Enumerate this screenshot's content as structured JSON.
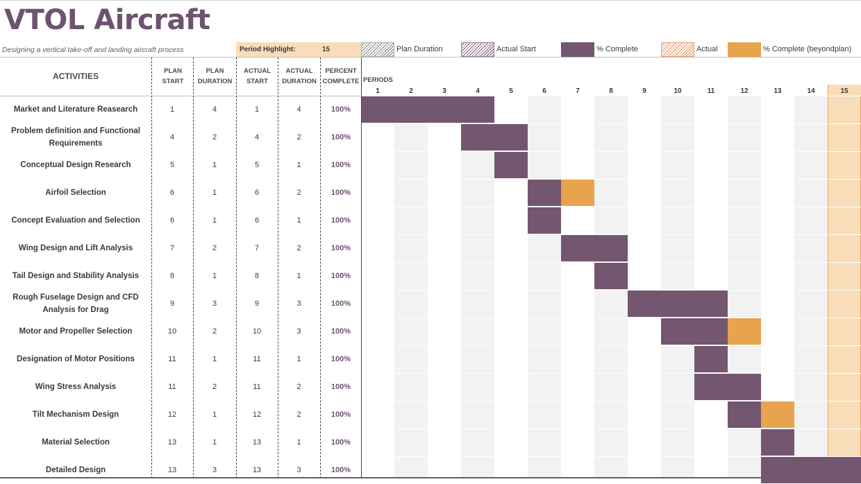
{
  "title": "VTOL Aircraft",
  "subtitle": "Designing a vertical take-off and landing aircraft process",
  "period_highlight": {
    "label": "Period Highlight:",
    "value": "15"
  },
  "legend": [
    {
      "key": "plan-duration",
      "label": "Plan Duration",
      "style": "hatch-gray"
    },
    {
      "key": "actual-start",
      "label": "Actual Start",
      "style": "hatch-purple"
    },
    {
      "key": "percent-complete",
      "label": "% Complete",
      "style": "solid-purple"
    },
    {
      "key": "actual",
      "label": "Actual",
      "style": "hatch-orange"
    },
    {
      "key": "percent-complete-beyond",
      "label": "% Complete (beyondplan)",
      "style": "solid-orange"
    }
  ],
  "colors": {
    "brand": "#6e5370",
    "complete": "#73566f",
    "beyond_plan": "#e8a44d",
    "highlight": "#f8ddb8",
    "alt_column": "#f2f2f2"
  },
  "headers": {
    "activities": "ACTIVITIES",
    "plan_start": [
      "PLAN",
      "START"
    ],
    "plan_duration": [
      "PLAN",
      "DURATION"
    ],
    "actual_start": [
      "ACTUAL",
      "START"
    ],
    "actual_duration": [
      "ACTUAL",
      "DURATION"
    ],
    "percent_complete": [
      "PERCENT",
      "COMPLETE"
    ],
    "periods": "PERIODS"
  },
  "periods": [
    "1",
    "2",
    "3",
    "4",
    "5",
    "6",
    "7",
    "8",
    "9",
    "10",
    "11",
    "12",
    "13",
    "14",
    "15"
  ],
  "activities": [
    {
      "name": "Market and Literature Reasearch",
      "plan_start": 1,
      "plan_duration": 4,
      "actual_start": 1,
      "actual_duration": 4,
      "percent": "100%"
    },
    {
      "name": "Problem definition and Functional Requirements",
      "plan_start": 4,
      "plan_duration": 2,
      "actual_start": 4,
      "actual_duration": 2,
      "percent": "100%"
    },
    {
      "name": "Conceptual Design Research",
      "plan_start": 5,
      "plan_duration": 1,
      "actual_start": 5,
      "actual_duration": 1,
      "percent": "100%"
    },
    {
      "name": "Airfoil Selection",
      "plan_start": 6,
      "plan_duration": 1,
      "actual_start": 6,
      "actual_duration": 2,
      "percent": "100%"
    },
    {
      "name": "Concept Evaluation and Selection",
      "plan_start": 6,
      "plan_duration": 1,
      "actual_start": 6,
      "actual_duration": 1,
      "percent": "100%"
    },
    {
      "name": "Wing Design and Lift Analysis",
      "plan_start": 7,
      "plan_duration": 2,
      "actual_start": 7,
      "actual_duration": 2,
      "percent": "100%"
    },
    {
      "name": "Tail Design and Stability Analysis",
      "plan_start": 8,
      "plan_duration": 1,
      "actual_start": 8,
      "actual_duration": 1,
      "percent": "100%"
    },
    {
      "name": "Rough Fuselage Design and CFD Analysis for Drag",
      "plan_start": 9,
      "plan_duration": 3,
      "actual_start": 9,
      "actual_duration": 3,
      "percent": "100%"
    },
    {
      "name": "Motor and Propeller Selection",
      "plan_start": 10,
      "plan_duration": 2,
      "actual_start": 10,
      "actual_duration": 3,
      "percent": "100%"
    },
    {
      "name": "Designation of Motor Positions",
      "plan_start": 11,
      "plan_duration": 1,
      "actual_start": 11,
      "actual_duration": 1,
      "percent": "100%"
    },
    {
      "name": "Wing Stress Analysis",
      "plan_start": 11,
      "plan_duration": 2,
      "actual_start": 11,
      "actual_duration": 2,
      "percent": "100%"
    },
    {
      "name": "Tilt Mechanism Design",
      "plan_start": 12,
      "plan_duration": 1,
      "actual_start": 12,
      "actual_duration": 2,
      "percent": "100%"
    },
    {
      "name": "Material Selection",
      "plan_start": 13,
      "plan_duration": 1,
      "actual_start": 13,
      "actual_duration": 1,
      "percent": "100%"
    },
    {
      "name": "Detailed Design",
      "plan_start": 13,
      "plan_duration": 3,
      "actual_start": 13,
      "actual_duration": 3,
      "percent": "100%"
    }
  ]
}
